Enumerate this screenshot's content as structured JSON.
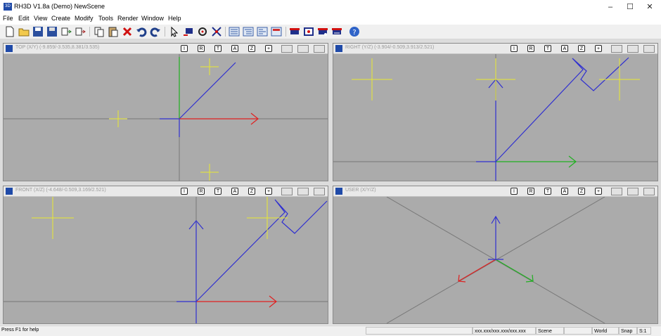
{
  "window": {
    "title": "RH3D V1.8a (Demo) NewScene",
    "icon": "rh3d-app-icon",
    "controls": [
      "–",
      "☐",
      "✕"
    ]
  },
  "menu": [
    "File",
    "Edit",
    "View",
    "Create",
    "Modify",
    "Tools",
    "Render",
    "Window",
    "Help"
  ],
  "toolbar": {
    "buttons": [
      "new-file-icon",
      "open-folder-icon",
      "save-icon",
      "save-as-icon",
      "import-icon",
      "export-icon",
      "copy-icon",
      "paste-icon",
      "delete-icon",
      "undo-icon",
      "redo-icon",
      "select-arrow-icon",
      "move-icon",
      "rotate-icon",
      "scale-icon",
      "list-view-1-icon",
      "list-view-2-icon",
      "list-view-3-icon",
      "list-view-4-icon",
      "render-1-icon",
      "render-2-icon",
      "render-3-icon",
      "render-4-icon",
      "help-icon"
    ]
  },
  "viewports": {
    "top": {
      "label": "TOP (X/Y) (-9.859/-3.535,8.381/3.535)"
    },
    "right": {
      "label": "RIGHT (Y/Z) (-3.904/-0.509,3.913/2.521)"
    },
    "front": {
      "label": "FRONT (X/Z) (-4.648/-0.509,3.169/2.521)"
    },
    "user": {
      "label": "USER (X/Y/Z)"
    },
    "tools": [
      "I",
      "R",
      "T",
      "A",
      "Z",
      "+"
    ]
  },
  "colors": {
    "viewport_bg": "#ababab",
    "axis_x": "#e02020",
    "axis_y": "#20b020",
    "axis_z": "#2020d0",
    "object_line": "#3030d0",
    "light": "#e8e830"
  },
  "status": {
    "help": "Press F1 for help",
    "coords": "xxx.xxx/xxx.xxx/xxx.xxx",
    "scene": "Scene",
    "world": "World",
    "snap": "Snap",
    "scale": "S:1"
  }
}
